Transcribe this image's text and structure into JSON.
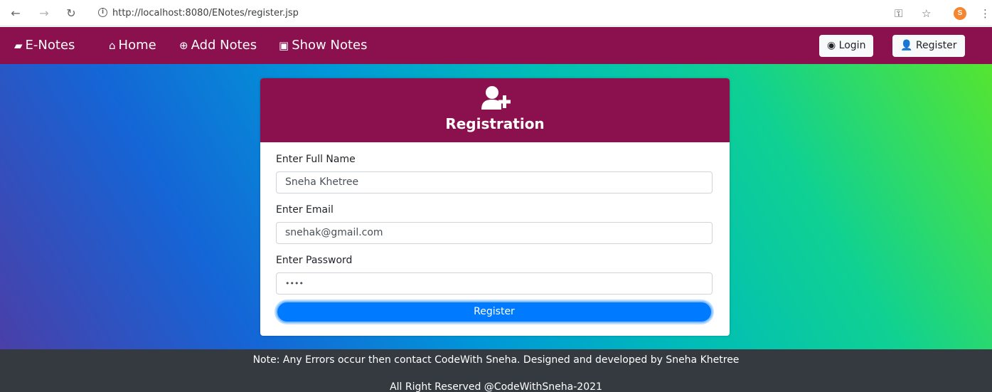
{
  "browser": {
    "url": "http://localhost:8080/ENotes/register.jsp",
    "back_icon": "arrow-left-icon",
    "forward_icon": "arrow-right-icon",
    "reload_icon": "reload-icon",
    "profile_initial": "S"
  },
  "nav": {
    "brand": "E-Notes",
    "links": [
      "Home",
      "Add Notes",
      "Show Notes"
    ],
    "login_label": "Login",
    "register_label": "Register",
    "bg_color": "#8b104e"
  },
  "form": {
    "title": "Registration",
    "fields": [
      {
        "label": "Enter Full Name",
        "value": "Sneha Khetree"
      },
      {
        "label": "Enter Email",
        "value": "snehak@gmail.com"
      },
      {
        "label": "Enter Password",
        "value": "••••"
      }
    ],
    "submit_label": "Register",
    "accent_color": "#007bff"
  },
  "footer": {
    "line1": "Note: Any Errors occur then contact CodeWith Sneha. Designed and developed by Sneha Khetree",
    "line2": "All Right Reserved @CodeWithSneha-2021"
  }
}
